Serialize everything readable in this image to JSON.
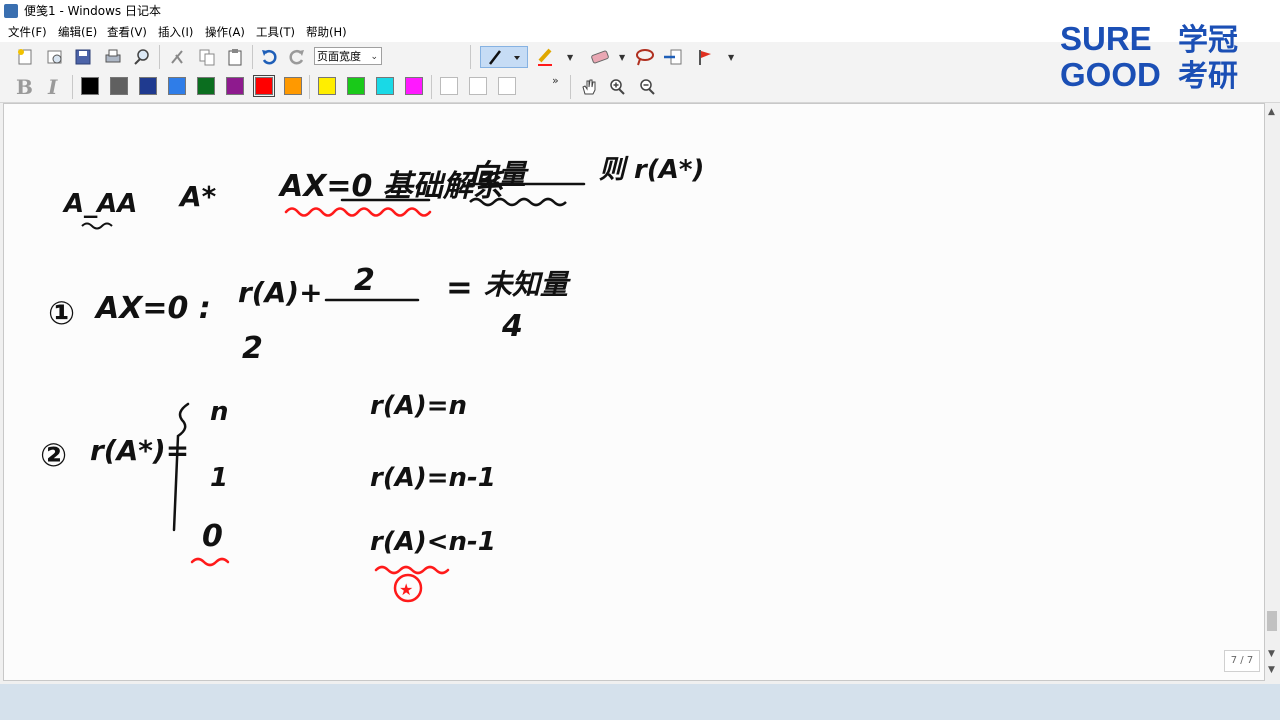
{
  "window": {
    "title": "便笺1 - Windows 日记本"
  },
  "menu": {
    "items": [
      "文件(F)",
      "编辑(E)",
      "查看(V)",
      "插入(I)",
      "操作(A)",
      "工具(T)",
      "帮助(H)"
    ]
  },
  "toolbar": {
    "page_width_label": "页面宽度"
  },
  "palette": {
    "colors": [
      "#000000",
      "#606060",
      "#1f3a8f",
      "#2f7de8",
      "#0b6e1f",
      "#8e1a8e",
      "#ff0000",
      "#ff9900",
      "#ffee00",
      "#19c919",
      "#19d9e6",
      "#ff19ff",
      "#ffffff",
      "#ffffff",
      "#ffffff"
    ],
    "selected_index": 6
  },
  "logo": {
    "line1": "SURE",
    "line2": "GOOD",
    "cn1": "学冠",
    "cn2": "考研",
    "color": "#1b4fb5"
  },
  "status": {
    "page_indicator": "7 / 7"
  },
  "notes": {
    "top_1": "A_AA",
    "top_2": "A*",
    "top_3": "AX=0 基础解系",
    "top_4": "向量",
    "top_5": "则 r(A*)",
    "item1_label": "①",
    "item1_eq": "AX=0 :",
    "item1_r": "r(A)+",
    "item1_num": "2",
    "item1_den": "2",
    "item1_equals": "=",
    "item1_right": "未知量",
    "item1_right_sub": "4",
    "item2_label": "②",
    "item2_eq": "r(A*)=",
    "case1_val": "n",
    "case1_cond": "r(A)=n",
    "case2_val": "1",
    "case2_cond": "r(A)=n-1",
    "case3_val": "0",
    "case3_cond": "r(A)<n-1",
    "star_mark": "★"
  },
  "ink_colors": {
    "black": "#111111",
    "red": "#ff1a1a"
  }
}
